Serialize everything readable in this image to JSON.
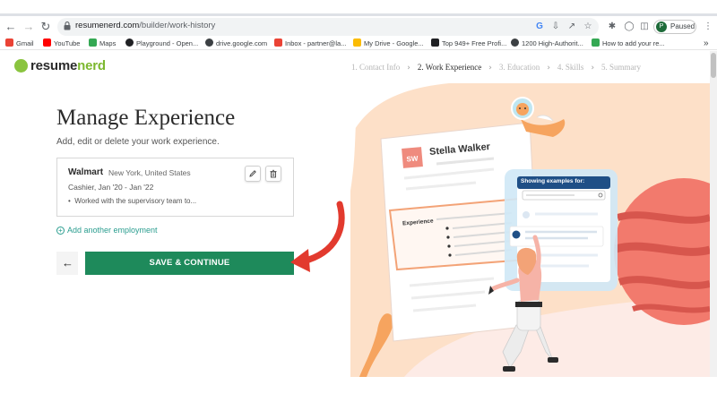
{
  "browser": {
    "url_host": "resumenerd.com",
    "url_path": "/builder/work-history",
    "profile_initial": "P",
    "profile_status": "Paused",
    "bookmarks": [
      {
        "label": "Gmail",
        "color": "#ea4335"
      },
      {
        "label": "YouTube",
        "color": "#ff0000"
      },
      {
        "label": "Maps",
        "color": "#34a853"
      },
      {
        "label": "Playground - Open...",
        "color": "#202124"
      },
      {
        "label": "drive.google.com",
        "color": "#202124"
      },
      {
        "label": "Inbox - partner@la...",
        "color": "#ea4335"
      },
      {
        "label": "My Drive - Google...",
        "color": "#fbbc04"
      },
      {
        "label": "Top 949+ Free Profi...",
        "color": "#202124"
      },
      {
        "label": "1200 High-Authorit...",
        "color": "#202124"
      },
      {
        "label": "How to add your re...",
        "color": "#34a853"
      }
    ],
    "bookmarks_overflow": "»"
  },
  "header": {
    "logo_part1": "resume",
    "logo_part2": "nerd",
    "steps": [
      {
        "label": "1. Contact Info",
        "active": false
      },
      {
        "label": "2. Work Experience",
        "active": true
      },
      {
        "label": "3. Education",
        "active": false
      },
      {
        "label": "4. Skills",
        "active": false
      },
      {
        "label": "5. Summary",
        "active": false
      }
    ]
  },
  "main": {
    "title": "Manage Experience",
    "subtitle": "Add, edit or delete your work experience.",
    "experience": {
      "company": "Walmart",
      "location": "New York, United States",
      "role_dates": "Cashier, Jan '20 - Jan '22",
      "bullet": "Worked with the supervisory team to..."
    },
    "add_link": "Add another employment",
    "save_label": "SAVE & CONTINUE"
  },
  "illustration": {
    "resume_initials": "SW",
    "resume_name": "Stella Walker",
    "section_label": "Experience",
    "panel_title": "Showing examples for:"
  },
  "colors": {
    "accent_green": "#1e8a5b",
    "logo_green": "#7cb82f",
    "link_teal": "#2a9d8f",
    "arrow_red": "#e23a2e",
    "peach_bg": "#fde0c8"
  }
}
